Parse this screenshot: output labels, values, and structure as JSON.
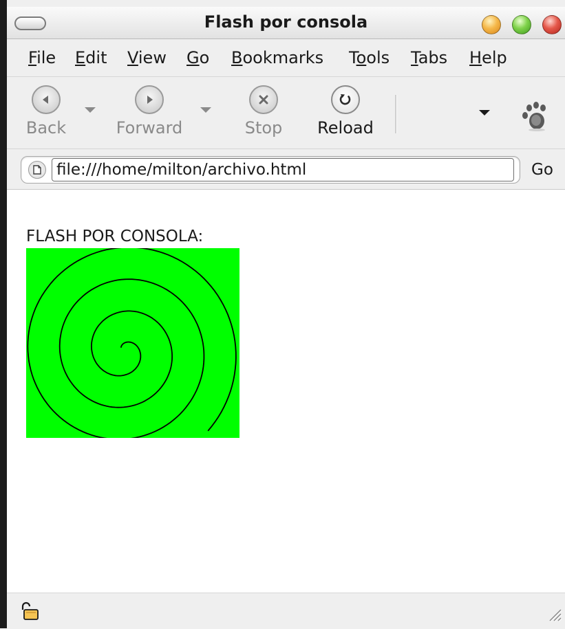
{
  "window": {
    "title": "Flash por consola"
  },
  "menubar": {
    "items": [
      {
        "mnemonic": "F",
        "rest": "ile"
      },
      {
        "mnemonic": "E",
        "rest": "dit"
      },
      {
        "mnemonic": "V",
        "rest": "iew"
      },
      {
        "mnemonic": "G",
        "rest": "o"
      },
      {
        "mnemonic": "B",
        "rest": "ookmarks"
      },
      {
        "pre": "T",
        "mnemonic": "o",
        "rest": "ols"
      },
      {
        "mnemonic": "T",
        "rest": "abs"
      },
      {
        "mnemonic": "H",
        "rest": "elp"
      }
    ]
  },
  "toolbar": {
    "back_label": "Back",
    "forward_label": "Forward",
    "stop_label": "Stop",
    "reload_label": "Reload"
  },
  "location": {
    "url": "file:///home/milton/archivo.html",
    "go_label": "Go"
  },
  "page": {
    "heading": "FLASH POR CONSOLA:",
    "flash_background": "#00ff00",
    "stroke_color": "#000000"
  },
  "icons": {
    "back": "back-arrow-icon",
    "forward": "forward-arrow-icon",
    "stop": "stop-x-icon",
    "reload": "reload-icon",
    "page": "page-icon",
    "gnome": "gnome-foot-icon",
    "lock": "unlocked-padlock-icon"
  }
}
